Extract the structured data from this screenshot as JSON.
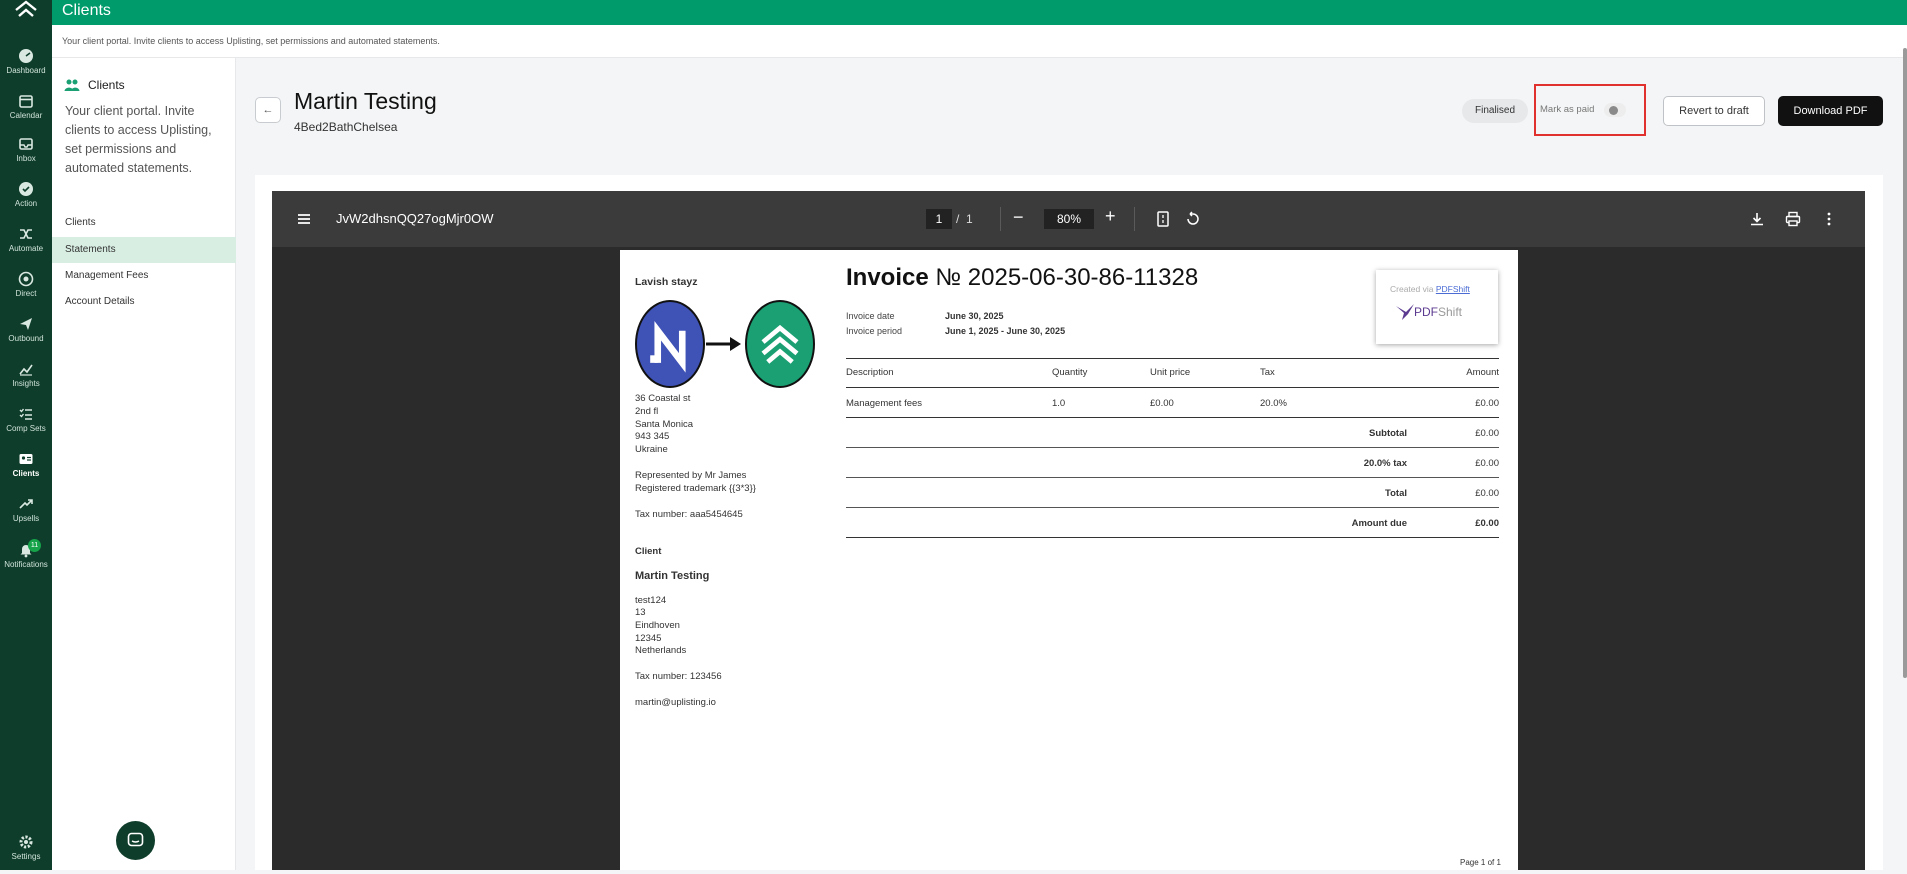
{
  "app": {
    "page_title": "Clients",
    "page_description": "Your client portal. Invite clients to access Uplisting, set permissions and automated statements."
  },
  "rail": {
    "items": [
      {
        "label": "Dashboard",
        "icon": "dashboard-icon"
      },
      {
        "label": "Calendar",
        "icon": "calendar-icon"
      },
      {
        "label": "Inbox",
        "icon": "inbox-icon"
      },
      {
        "label": "Action",
        "icon": "action-icon"
      },
      {
        "label": "Automate",
        "icon": "automate-icon"
      },
      {
        "label": "Direct",
        "icon": "direct-icon"
      },
      {
        "label": "Outbound",
        "icon": "outbound-icon"
      },
      {
        "label": "Insights",
        "icon": "insights-icon"
      },
      {
        "label": "Comp Sets",
        "icon": "comp-sets-icon"
      },
      {
        "label": "Clients",
        "icon": "clients-icon",
        "active": true
      },
      {
        "label": "Upsells",
        "icon": "upsells-icon"
      },
      {
        "label": "Notifications",
        "icon": "bell-icon",
        "badge": "11"
      }
    ],
    "settings_label": "Settings"
  },
  "sidepanel": {
    "heading": "Clients",
    "description": "Your client portal. Invite clients to access Uplisting, set permissions and automated statements.",
    "links": [
      "Clients",
      "Statements",
      "Management Fees",
      "Account Details"
    ],
    "active_link": "Statements"
  },
  "header": {
    "back_label": "←",
    "client_name": "Martin Testing",
    "property": "4Bed2BathChelsea",
    "status_pill": "Finalised",
    "mark_paid_label": "Mark as paid",
    "mark_paid_on": false,
    "revert_label": "Revert to draft",
    "download_label": "Download PDF"
  },
  "viewer": {
    "file_name": "JvW2dhsnQQ27ogMjr0OW",
    "current_page": "1",
    "page_sep": "/",
    "total_pages": "1",
    "zoom": "80%",
    "minus": "−",
    "plus": "+"
  },
  "invoice": {
    "title_word": "Invoice",
    "number": "№ 2025-06-30-86-11328",
    "company": "Lavish stayz",
    "company_address": [
      "36 Coastal st",
      "2nd fl",
      "Santa Monica",
      "943 345",
      "Ukraine"
    ],
    "represented": "Represented by Mr James",
    "trademark": "Registered trademark {{3*3}}",
    "company_tax": "Tax number: aaa5454645",
    "client_heading": "Client",
    "client_name": "Martin Testing",
    "client_address": [
      "test124",
      "13",
      "Eindhoven",
      "12345",
      "Netherlands"
    ],
    "client_tax": "Tax number: 123456",
    "client_email": "martin@uplisting.io",
    "invoice_date_label": "Invoice date",
    "invoice_date": "June 30, 2025",
    "invoice_period_label": "Invoice period",
    "invoice_period": "June 1, 2025 - June 30, 2025",
    "created_via": "Created via",
    "created_via_link": "PDFShift",
    "pdfshift_brand_a": "PDF",
    "pdfshift_brand_b": "Shift",
    "columns": [
      "Description",
      "Quantity",
      "Unit price",
      "Tax",
      "Amount"
    ],
    "rows": [
      {
        "description": "Management fees",
        "quantity": "1.0",
        "unit_price": "£0.00",
        "tax": "20.0%",
        "amount": "£0.00"
      }
    ],
    "totals": [
      {
        "label": "Subtotal",
        "value": "£0.00"
      },
      {
        "label": "20.0% tax",
        "value": "£0.00"
      },
      {
        "label": "Total",
        "value": "£0.00"
      },
      {
        "label": "Amount due",
        "value": "£0.00"
      }
    ],
    "page_footer": "Page 1 of 1"
  },
  "colors": {
    "brand_green": "#009b6b",
    "rail_dark": "#0f3d2b",
    "highlight_red": "#e0312f"
  }
}
